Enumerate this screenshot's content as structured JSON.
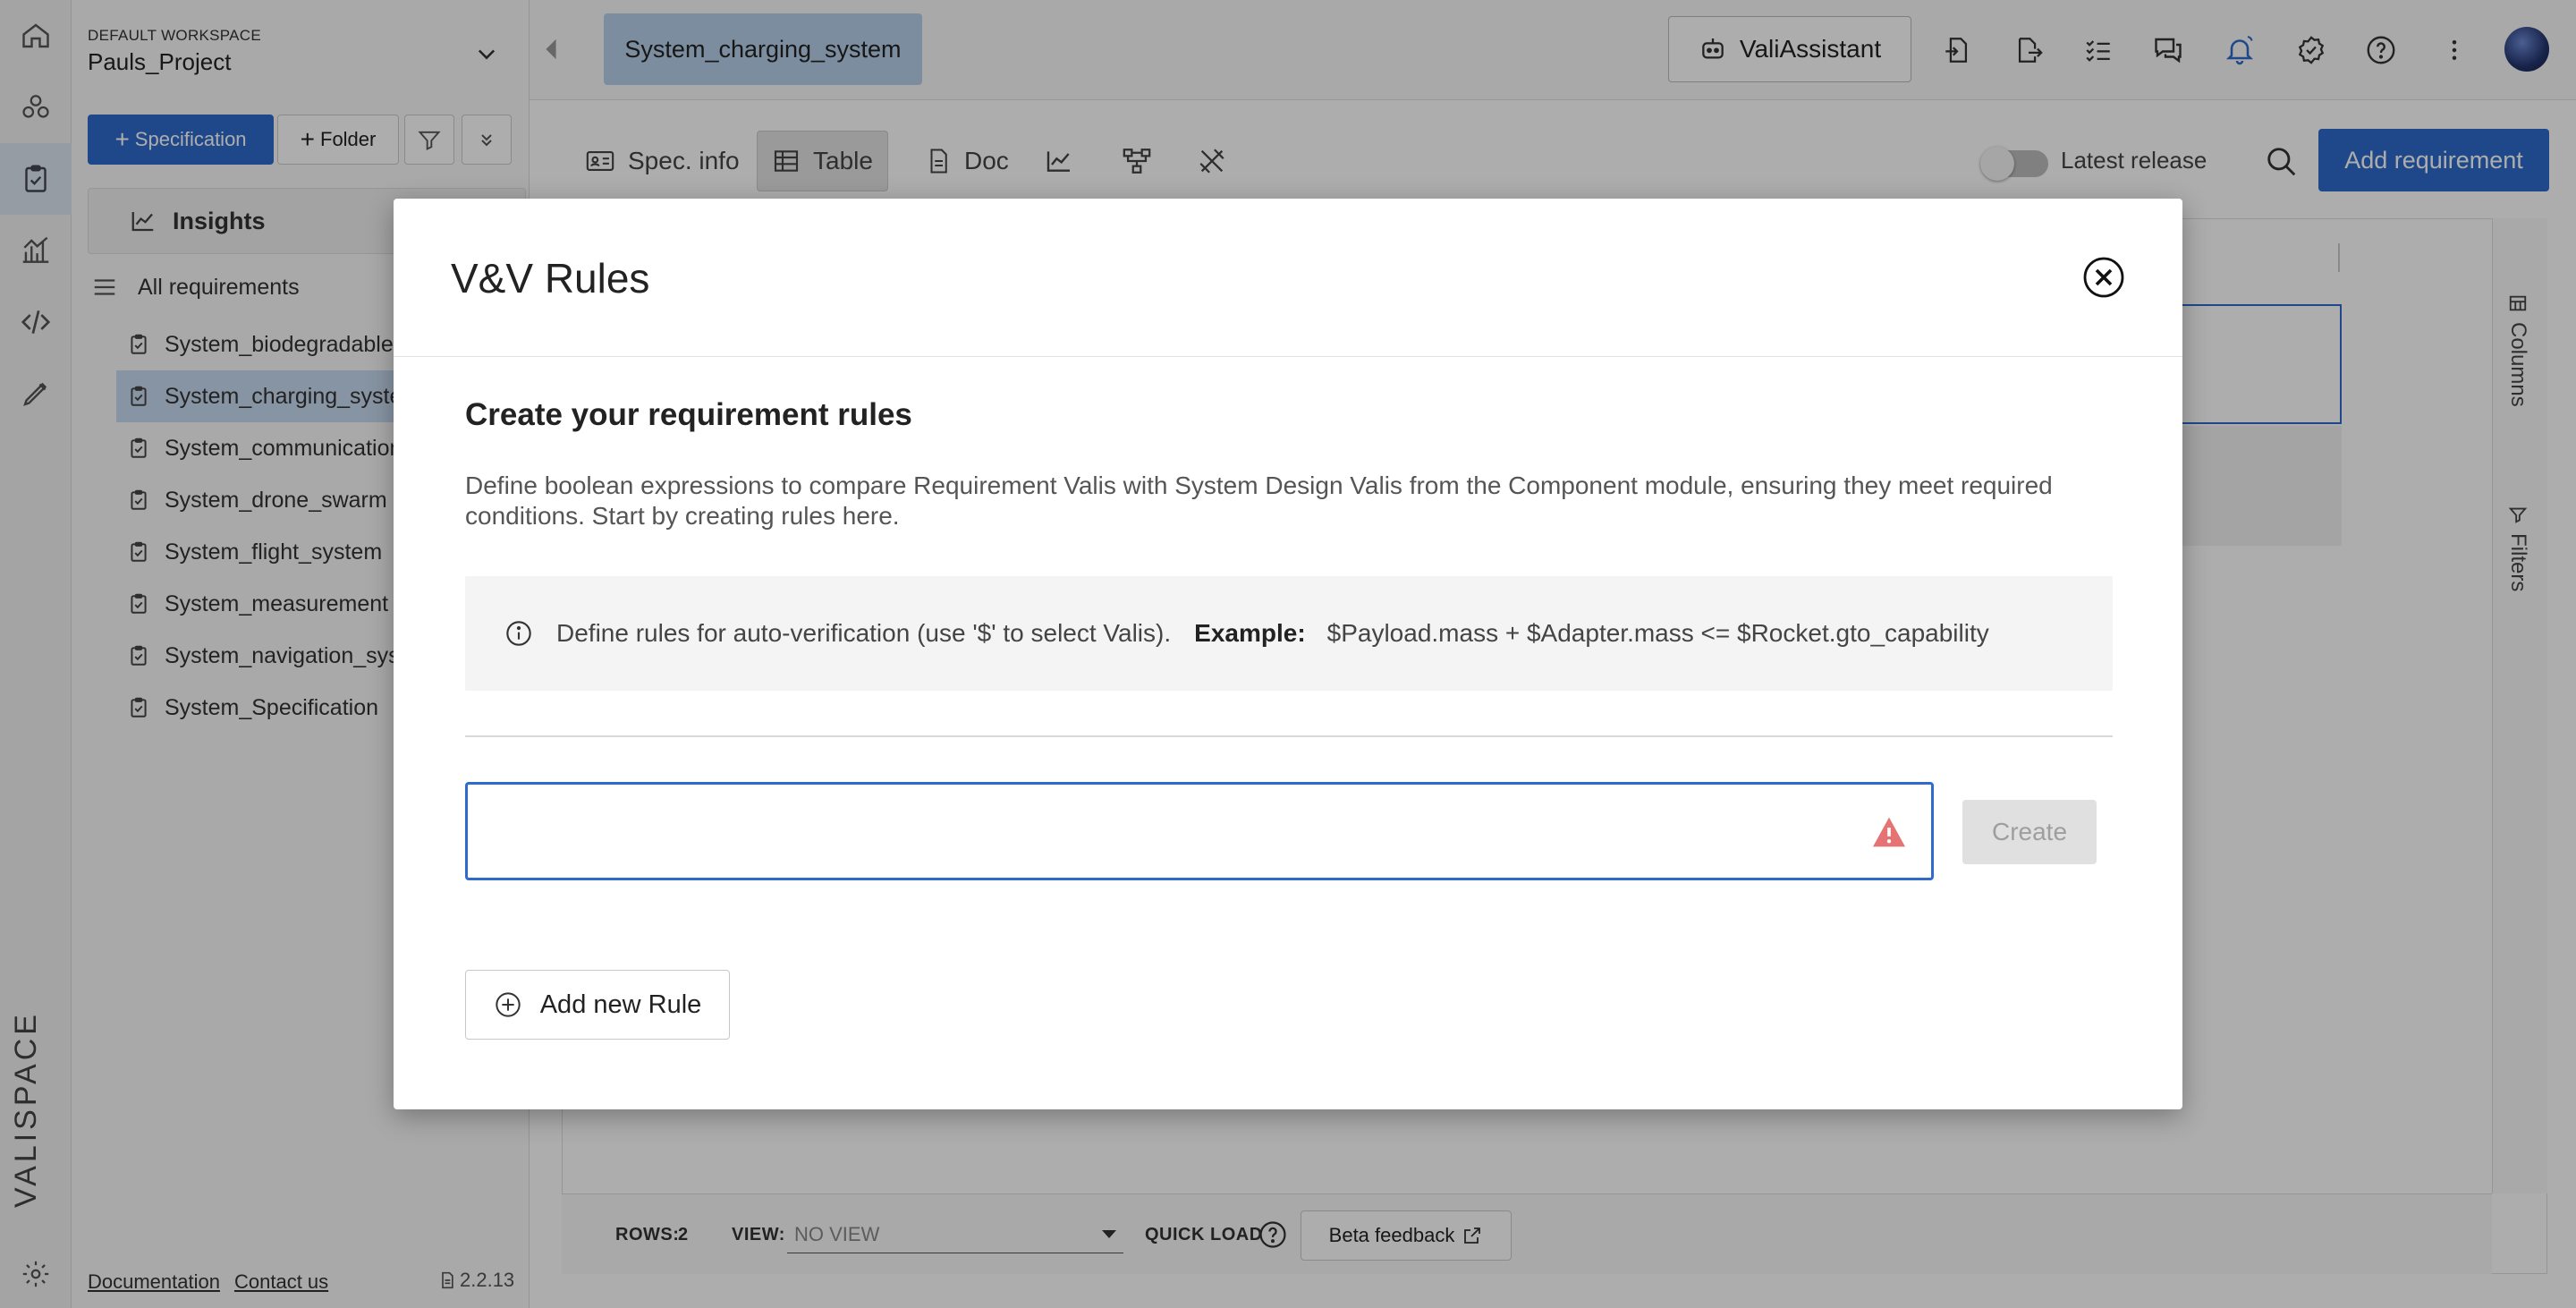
{
  "workspace": {
    "label": "DEFAULT WORKSPACE",
    "project": "Pauls_Project"
  },
  "sidebar": {
    "specification_label": "Specification",
    "folder_label": "Folder",
    "insights_label": "Insights",
    "all_requirements_label": "All requirements",
    "items": [
      {
        "label": "System_biodegradable"
      },
      {
        "label": "System_charging_system"
      },
      {
        "label": "System_communication"
      },
      {
        "label": "System_drone_swarm"
      },
      {
        "label": "System_flight_system"
      },
      {
        "label": "System_measurement"
      },
      {
        "label": "System_navigation_system"
      },
      {
        "label": "System_Specification"
      }
    ],
    "documentation_link": "Documentation",
    "contact_link": "Contact us",
    "version": "2.2.13"
  },
  "header": {
    "active_spec": "System_charging_system",
    "assistant_label": "ValiAssistant"
  },
  "toolbar": {
    "spec_info": "Spec. info",
    "table": "Table",
    "doc": "Doc",
    "latest_release": "Latest release",
    "add_requirement": "Add requirement"
  },
  "side_panel": {
    "columns": "Columns",
    "filters": "Filters"
  },
  "bottombar": {
    "rows_label": "ROWS:",
    "rows_value": "2",
    "view_label": "VIEW:",
    "view_value": "NO VIEW",
    "quick_load": "QUICK LOAD",
    "beta_feedback": "Beta feedback"
  },
  "modal": {
    "title": "V&V Rules",
    "heading": "Create your requirement rules",
    "description": "Define boolean expressions to compare Requirement Valis with System Design Valis from the Component module, ensuring they meet required conditions. Start by creating rules here.",
    "info_text": "Define rules for auto-verification (use '$' to select Valis).",
    "example_label": "Example:",
    "example_value": "$Payload.mass + $Adapter.mass <= $Rocket.gto_capability",
    "rule_input_value": "",
    "create_label": "Create",
    "add_rule_label": "Add new Rule"
  },
  "colors": {
    "accent": "#2f6bcc",
    "selected_tab": "#b9d0ec",
    "warning": "#e57373"
  }
}
